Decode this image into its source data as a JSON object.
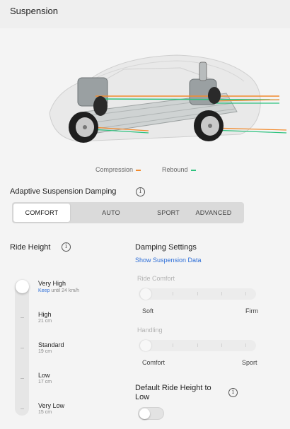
{
  "header": {
    "title": "Suspension"
  },
  "legend": {
    "compression_label": "Compression",
    "rebound_label": "Rebound",
    "compression_color": "#f28a2c",
    "rebound_color": "#2ec27e"
  },
  "damping": {
    "title": "Adaptive Suspension Damping",
    "options": [
      "COMFORT",
      "AUTO",
      "SPORT",
      "ADVANCED"
    ],
    "selected": "COMFORT"
  },
  "ride_height": {
    "title": "Ride Height",
    "levels": [
      {
        "name": "Very High",
        "sub": "Keep",
        "sub2": "until 24 km/h"
      },
      {
        "name": "High",
        "sub": "21 cm"
      },
      {
        "name": "Standard",
        "sub": "19 cm"
      },
      {
        "name": "Low",
        "sub": "17 cm"
      },
      {
        "name": "Very Low",
        "sub": "15 cm"
      }
    ],
    "selected": "Very High"
  },
  "damping_settings": {
    "title": "Damping Settings",
    "link": "Show Suspension Data",
    "ride_comfort": {
      "label": "Ride Comfort",
      "min_label": "Soft",
      "max_label": "Firm"
    },
    "handling": {
      "label": "Handling",
      "min_label": "Comfort",
      "max_label": "Sport"
    }
  },
  "default_low": {
    "title_line1": "Default Ride Height to",
    "title_line2": "Low",
    "enabled": false
  },
  "icons": [
    "info-icon",
    "car-chassis-illustration"
  ]
}
